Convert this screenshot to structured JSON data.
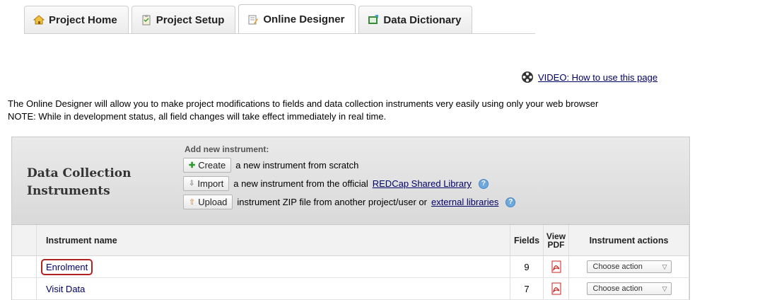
{
  "tabs": [
    {
      "label": "Project Home",
      "icon": "home-icon"
    },
    {
      "label": "Project Setup",
      "icon": "checklist-icon"
    },
    {
      "label": "Online Designer",
      "icon": "designer-icon",
      "active": true
    },
    {
      "label": "Data Dictionary",
      "icon": "spreadsheet-icon"
    }
  ],
  "video_link": "VIDEO: How to use this page",
  "intro": {
    "line1": "The Online Designer will allow you to make project modifications to fields and data collection instruments very easily using only your web browser",
    "line2": "NOTE: While in development status, all field changes will take effect immediately in real time."
  },
  "panel": {
    "title_line1": "Data Collection",
    "title_line2": "Instruments",
    "add_label": "Add new instrument:",
    "create": {
      "button": "Create",
      "text": "a new instrument from scratch"
    },
    "import": {
      "button": "Import",
      "text": "a new instrument from the official",
      "link": "REDCap Shared Library"
    },
    "upload": {
      "button": "Upload",
      "text": "instrument ZIP file from another project/user or",
      "link": "external libraries"
    }
  },
  "columns": {
    "name": "Instrument name",
    "fields": "Fields",
    "pdf_line1": "View",
    "pdf_line2": "PDF",
    "actions": "Instrument actions"
  },
  "instruments": [
    {
      "name": "Enrolment",
      "fields": "9",
      "action": "Choose action"
    },
    {
      "name": "Visit Data",
      "fields": "7",
      "action": "Choose action"
    }
  ],
  "colors": {
    "link": "#000066",
    "highlight": "#b22222",
    "pdf_red": "#cc2222"
  }
}
